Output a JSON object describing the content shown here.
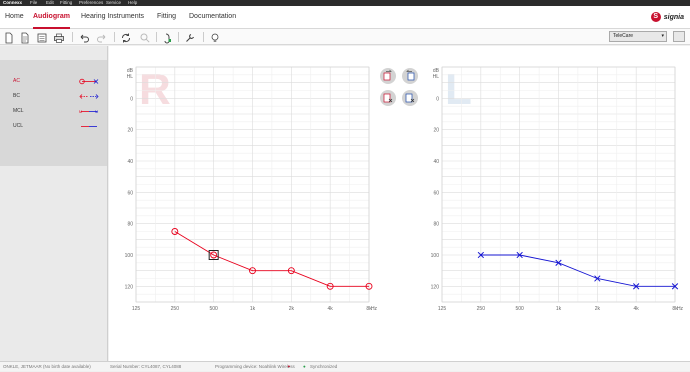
{
  "titlebar": {
    "app": "Connexx",
    "menus": [
      "File",
      "Edit",
      "Fitting",
      "Preferences",
      "Service",
      "Help"
    ]
  },
  "nav": {
    "tabs": [
      {
        "label": "Home",
        "active": false
      },
      {
        "label": "Audiogram",
        "active": true
      },
      {
        "label": "Hearing Instruments",
        "active": false
      },
      {
        "label": "Fitting",
        "active": false
      },
      {
        "label": "Documentation",
        "active": false
      }
    ],
    "brand": "signia"
  },
  "toolbar": {
    "icons": [
      "new-document-icon",
      "document-icon",
      "list-document-icon",
      "print-icon",
      "undo-icon",
      "redo-icon",
      "sync-icon",
      "search-icon",
      "hearing-instrument-icon",
      "wrench-icon",
      "lightbulb-icon"
    ],
    "program_select": "TeleCare"
  },
  "sidebar": {
    "legend": [
      {
        "label": "AC",
        "active": true
      },
      {
        "label": "BC",
        "active": false
      },
      {
        "label": "MCL",
        "active": false
      },
      {
        "label": "UCL",
        "active": false
      }
    ]
  },
  "colors": {
    "right": "#e8001c",
    "left": "#1414d2",
    "accent": "#c8102e"
  },
  "chart_data": [
    {
      "type": "line",
      "ear": "R",
      "ylabel": "dB HL",
      "xlabel": "Hz",
      "x_ticks": [
        "125",
        "250",
        "500",
        "1k",
        "2k",
        "4k",
        "8k"
      ],
      "y_ticks": [
        "0",
        "20",
        "40",
        "60",
        "80",
        "100",
        "120"
      ],
      "ylim": [
        -20,
        130
      ],
      "y_inverted": true,
      "grid": true,
      "series": [
        {
          "x": [
            "250",
            "500",
            "1k",
            "2k",
            "4k",
            "8k"
          ],
          "y": [
            85,
            100,
            110,
            110,
            120,
            120
          ],
          "marker": "circle"
        }
      ]
    },
    {
      "type": "line",
      "ear": "L",
      "ylabel": "dB HL",
      "xlabel": "Hz",
      "x_ticks": [
        "125",
        "250",
        "500",
        "1k",
        "2k",
        "4k",
        "8k"
      ],
      "y_ticks": [
        "0",
        "20",
        "40",
        "60",
        "80",
        "100",
        "120"
      ],
      "ylim": [
        -20,
        130
      ],
      "y_inverted": true,
      "grid": true,
      "series": [
        {
          "x": [
            "250",
            "500",
            "1k",
            "2k",
            "4k",
            "8k"
          ],
          "y": [
            100,
            100,
            105,
            115,
            120,
            120
          ],
          "marker": "cross"
        }
      ]
    }
  ],
  "status": {
    "patient": "ONKLE, JETMAAR (No birth date available)",
    "serial": "Serial Number: CYL4087, CYL4088",
    "programming_device": "Programming device: Noahlink Wireless",
    "sync": "Synchronized"
  }
}
